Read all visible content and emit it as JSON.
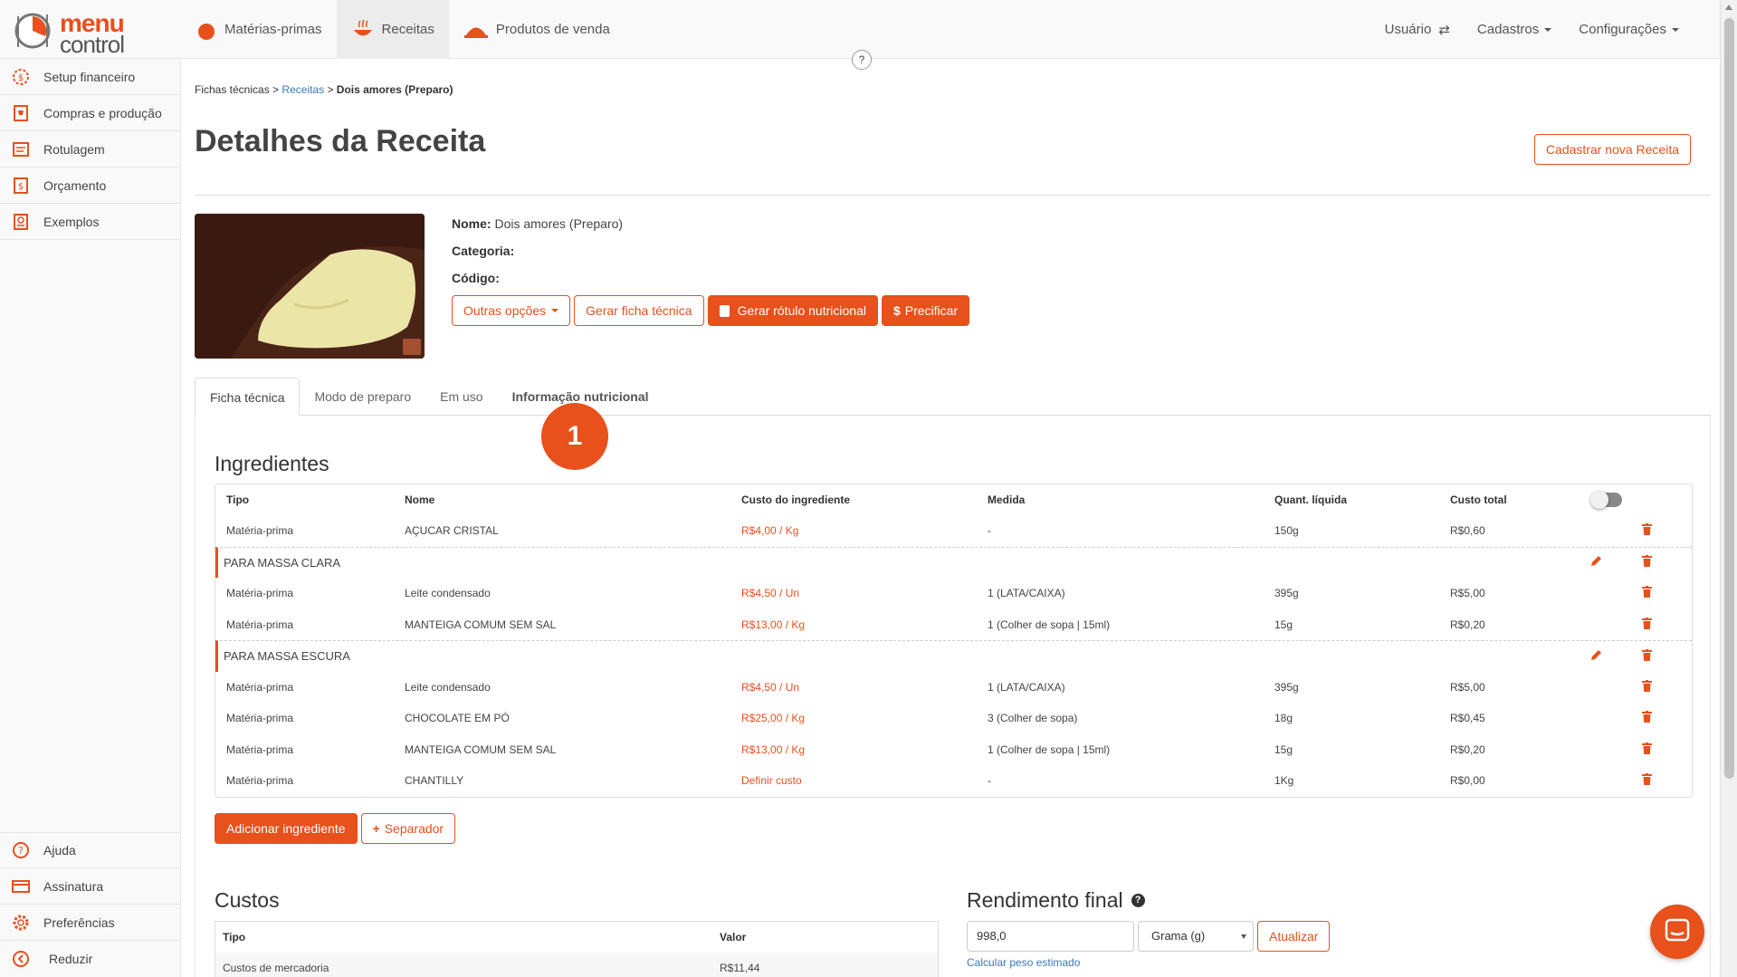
{
  "brand": {
    "logo_line1": "menu",
    "logo_line2": "control",
    "accent": "#e8501c",
    "link": "#3a79b8"
  },
  "nav": {
    "items": [
      {
        "label": "Matérias-primas",
        "icon": "tomato-icon"
      },
      {
        "label": "Receitas",
        "icon": "pot-icon"
      },
      {
        "label": "Produtos de venda",
        "icon": "cloche-icon"
      }
    ],
    "user_label": "Usuário",
    "cadastros_label": "Cadastros",
    "config_label": "Configurações",
    "help_label": "?"
  },
  "sidebar": {
    "items": [
      {
        "label": "Setup financeiro",
        "icon": "gear-dollar-icon"
      },
      {
        "label": "Compras e produção",
        "icon": "shopping-cart-icon"
      },
      {
        "label": "Rotulagem",
        "icon": "label-icon"
      },
      {
        "label": "Orçamento",
        "icon": "budget-icon"
      },
      {
        "label": "Exemplos",
        "icon": "book-icon"
      }
    ],
    "bottom": [
      {
        "label": "Ajuda",
        "icon": "help-icon"
      },
      {
        "label": "Assinatura",
        "icon": "card-icon"
      },
      {
        "label": "Preferências",
        "icon": "gear-icon"
      },
      {
        "label": "Reduzir",
        "icon": "collapse-icon"
      }
    ]
  },
  "breadcrumb": {
    "part1": "Fichas técnicas",
    "part2": "Receitas",
    "part3": "Dois amores (Preparo)",
    "sep": ">"
  },
  "page": {
    "title": "Detalhes da Receita",
    "new_recipe_label": "Cadastrar nova Receita"
  },
  "recipe": {
    "name_label": "Nome:",
    "name_value": "Dois amores (Preparo)",
    "category_label": "Categoria:",
    "code_label": "Código:",
    "more_options_label": "Outras opções",
    "gen_sheet_label": "Gerar ficha técnica",
    "gen_label_label": "Gerar rótulo nutricional",
    "price_label": "Precificar"
  },
  "tabs": [
    {
      "label": "Ficha técnica"
    },
    {
      "label": "Modo de preparo"
    },
    {
      "label": "Em uso"
    },
    {
      "label": "Informação nutricional"
    }
  ],
  "step_badge": "1",
  "ingredients": {
    "title": "Ingredientes",
    "columns": [
      "Tipo",
      "Nome",
      "Custo do ingrediente",
      "Medida",
      "Quant. líquida",
      "Custo total"
    ],
    "rows": [
      {
        "type": "item",
        "tipo": "Matéria-prima",
        "nome": "AÇUCAR CRISTAL",
        "custo": "R$4,00 / Kg",
        "medida": "-",
        "quant": "150g",
        "total": "R$0,60"
      },
      {
        "type": "separator",
        "label": "PARA MASSA CLARA"
      },
      {
        "type": "item",
        "tipo": "Matéria-prima",
        "nome": "Leite condensado",
        "custo": "R$4,50 / Un",
        "medida": "1 (LATA/CAIXA)",
        "quant": "395g",
        "total": "R$5,00"
      },
      {
        "type": "item",
        "tipo": "Matéria-prima",
        "nome": "MANTEIGA COMUM SEM SAL",
        "custo": "R$13,00 / Kg",
        "medida": "1 (Colher de sopa | 15ml)",
        "quant": "15g",
        "total": "R$0,20"
      },
      {
        "type": "separator",
        "label": "PARA MASSA ESCURA"
      },
      {
        "type": "item",
        "tipo": "Matéria-prima",
        "nome": "Leite condensado",
        "custo": "R$4,50 / Un",
        "medida": "1 (LATA/CAIXA)",
        "quant": "395g",
        "total": "R$5,00"
      },
      {
        "type": "item",
        "tipo": "Matéria-prima",
        "nome": "CHOCOLATE EM PÓ",
        "custo": "R$25,00 / Kg",
        "medida": "3 (Colher de sopa)",
        "quant": "18g",
        "total": "R$0,45"
      },
      {
        "type": "item",
        "tipo": "Matéria-prima",
        "nome": "MANTEIGA COMUM SEM SAL",
        "custo": "R$13,00 / Kg",
        "medida": "1 (Colher de sopa | 15ml)",
        "quant": "15g",
        "total": "R$0,20"
      },
      {
        "type": "item",
        "tipo": "Matéria-prima",
        "nome": "CHANTILLY",
        "custo": "Definir custo",
        "medida": "-",
        "quant": "1Kg",
        "total": "R$0,00"
      }
    ],
    "add_label": "Adicionar ingrediente",
    "separator_label": "Separador"
  },
  "costs": {
    "title": "Custos",
    "col_tipo": "Tipo",
    "col_valor": "Valor",
    "rows": [
      {
        "tipo": "Custos de mercadoria",
        "valor": "R$11,44"
      }
    ]
  },
  "yield": {
    "title": "Rendimento final",
    "value": "998,0",
    "unit": "Grama (g)",
    "update_label": "Atualizar",
    "estimate_link": "Calcular peso estimado"
  }
}
